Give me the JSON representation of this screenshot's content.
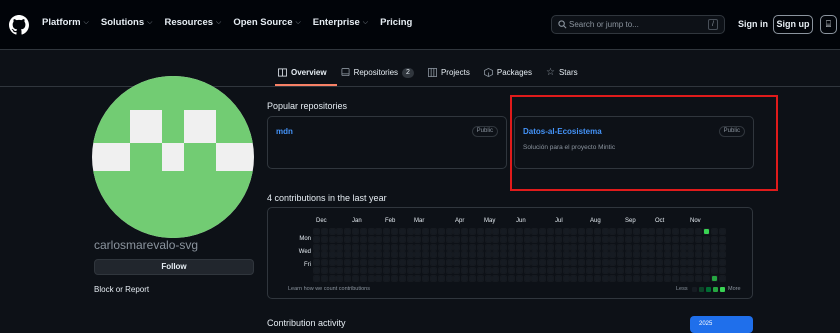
{
  "header": {
    "nav": [
      {
        "label": "Platform",
        "dropdown": true
      },
      {
        "label": "Solutions",
        "dropdown": true
      },
      {
        "label": "Resources",
        "dropdown": true
      },
      {
        "label": "Open Source",
        "dropdown": true
      },
      {
        "label": "Enterprise",
        "dropdown": true
      },
      {
        "label": "Pricing",
        "dropdown": false
      }
    ],
    "search_placeholder": "Search or jump to...",
    "search_shortcut": "/",
    "sign_in": "Sign in",
    "sign_up": "Sign up"
  },
  "tabs": [
    {
      "label": "Overview",
      "icon": "book-icon",
      "active": true
    },
    {
      "label": "Repositories",
      "icon": "repo-icon",
      "count": "2"
    },
    {
      "label": "Projects",
      "icon": "table-icon"
    },
    {
      "label": "Packages",
      "icon": "package-icon"
    },
    {
      "label": "Stars",
      "icon": "star-icon"
    }
  ],
  "profile": {
    "username": "carlosmarevalo-svg",
    "follow_label": "Follow",
    "block_report": "Block or Report",
    "avatar_colors": {
      "background": "#f0f0f0",
      "pattern": "#72cc73"
    }
  },
  "popular": {
    "title": "Popular repositories",
    "repos": [
      {
        "name": "mdn",
        "visibility": "Public",
        "description": ""
      },
      {
        "name": "Datos-al-Ecosistema",
        "visibility": "Public",
        "description": "Solución para el proyecto Mintic"
      }
    ]
  },
  "contributions": {
    "title": "4 contributions in the last year",
    "months": [
      "Dec",
      "Jan",
      "Feb",
      "Mar",
      "Apr",
      "May",
      "Jun",
      "Jul",
      "Aug",
      "Sep",
      "Oct",
      "Nov"
    ],
    "days": [
      "Mon",
      "Wed",
      "Fri"
    ],
    "learn_link": "Learn how we count contributions",
    "less": "Less",
    "more": "More",
    "colors": [
      "#161b22",
      "#0e4429",
      "#006d32",
      "#26a641",
      "#39d353"
    ]
  },
  "activity": {
    "title": "Contribution activity",
    "year": "2025"
  },
  "annotation": {
    "highlight_color": "#e01b1b"
  }
}
